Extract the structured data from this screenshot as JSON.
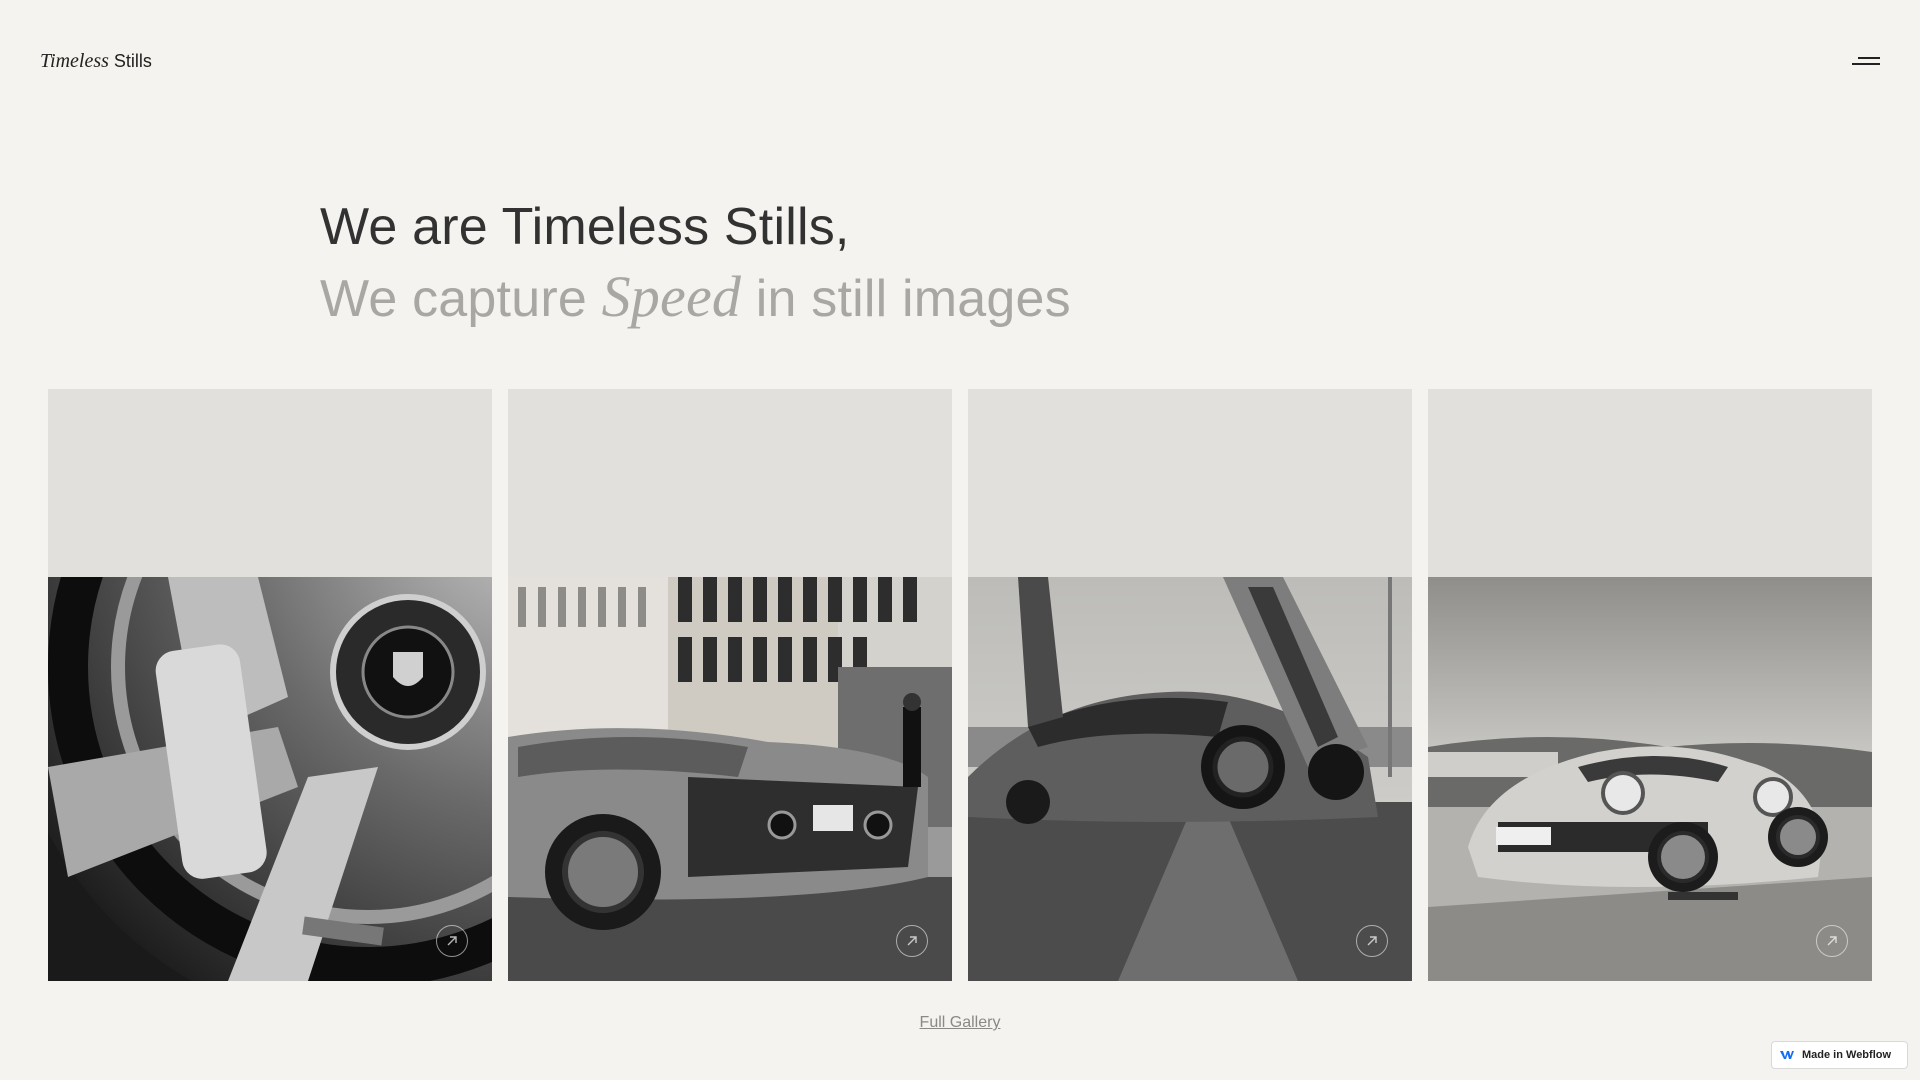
{
  "header": {
    "logo_italic": "Timeless",
    "logo_regular": "Stills"
  },
  "hero": {
    "line1": "We are Timeless Stills,",
    "line2_before": "We capture",
    "line2_italic": "Speed",
    "line2_after": "in still images"
  },
  "gallery": {
    "cards": [
      {
        "subject": "wheel"
      },
      {
        "subject": "lamborghini"
      },
      {
        "subject": "mclaren"
      },
      {
        "subject": "porsche-911"
      }
    ]
  },
  "footer": {
    "full_gallery_label": "Full Gallery"
  },
  "badge": {
    "label": "Made in Webflow"
  },
  "colors": {
    "background": "#f4f3ef",
    "card_placeholder": "#e1e0dd",
    "heading_dark": "#323232",
    "heading_light": "#a8a7a3",
    "webflow_blue": "#146ef5"
  }
}
